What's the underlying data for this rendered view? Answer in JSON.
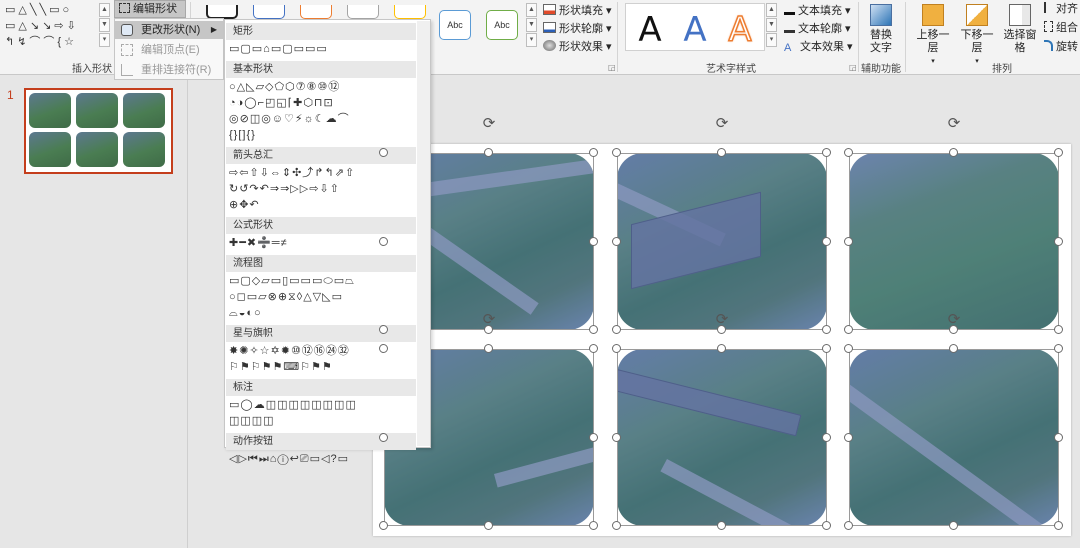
{
  "ribbon": {
    "insert_shapes": {
      "label": "插入形状",
      "shape_rows": [
        "▭△╲╲▭○",
        "▭△↘↘⇨⇩",
        "↰↯⌒⌒{☆"
      ]
    },
    "edit_shape_label": "编辑形状 ▾",
    "shape_styles": [
      "Abc",
      "Abc"
    ],
    "shape_fill": "形状填充",
    "shape_outline": "形状轮廓",
    "shape_effects": "形状效果",
    "wordart": {
      "label": "艺术字样式",
      "samples": [
        "A",
        "A",
        "A"
      ],
      "text_fill": "文本填充",
      "text_outline": "文本轮廓",
      "text_effects": "文本效果"
    },
    "accessibility": {
      "label": "辅助功能",
      "alt_text": [
        "替换",
        "文字"
      ]
    },
    "arrange": {
      "label": "排列",
      "bring_forward": "上移一层",
      "send_backward": "下移一层",
      "selection_pane": "选择窗格",
      "align": "对齐",
      "group": "组合",
      "rotate": "旋转"
    },
    "colors": {
      "wordart_black": "#111111",
      "wordart_blue": "#4472c4",
      "wordart_orange": "#ed7d31"
    }
  },
  "context_menu": {
    "change_shape": "更改形状(N)",
    "edit_points": "编辑顶点(E)",
    "reroute_connectors": "重排连接符(R)"
  },
  "gallery": {
    "categories": [
      {
        "name": "矩形",
        "rows": [
          "▭▢▭⌂▭▢▭▭▭"
        ]
      },
      {
        "name": "基本形状",
        "rows": [
          "○△◺▱◇⬠⬡⑦⑧⑩⑫",
          "◔◑◯⌐◰◱⌈✚⬡⊓⊡",
          "◎⊘◫◎☺♡⚡☼☾☁⌒",
          "{}[]{}"
        ]
      },
      {
        "name": "箭头总汇",
        "rows": [
          "⇨⇦⇧⇩⇔⇕✣⤴↱↰⇗⇧",
          "↻↺↷↶⇒⇒▷▷⇨⇩⇧",
          "⊕✥↶"
        ]
      },
      {
        "name": "公式形状",
        "rows": [
          "✚━✖➗═≠"
        ]
      },
      {
        "name": "流程图",
        "rows": [
          "▭▢◇▱▭▯▭▭▭⬭▭⏢",
          "○◻▭▱⊗⊕⧖◊△▽◺▭",
          "⌓◒◐○"
        ]
      },
      {
        "name": "星与旗帜",
        "rows": [
          "✸✺✧☆✡✹⑩⑫⑯㉔㉜",
          "⚐⚑⚐⚑⚑⌨⚐⚑⚑"
        ]
      },
      {
        "name": "标注",
        "rows": [
          "▭◯☁◫◫◫◫◫◫◫◫",
          "◫◫◫◫"
        ]
      },
      {
        "name": "动作按钮",
        "rows": [
          "◁▷⏮⏭⌂ⓘ↩⎚▭◁?▭"
        ]
      }
    ]
  },
  "slide_panel": {
    "slide_number": "1"
  }
}
